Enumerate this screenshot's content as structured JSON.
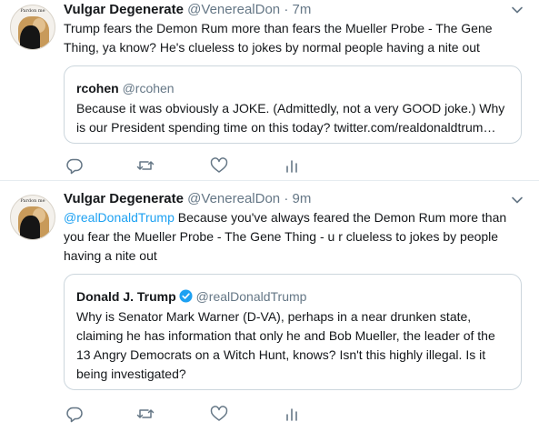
{
  "tweets": [
    {
      "name": "Vulgar Degenerate",
      "handle": "@VenerealDon",
      "separator": "·",
      "time": "7m",
      "avatar_caption": "Pardon me",
      "text": "Trump fears the Demon Rum more than fears the Mueller Probe - The Gene Thing, ya know? He's clueless to jokes by normal people having a nite out",
      "quote": {
        "name": "rcohen",
        "handle": "@rcohen",
        "text": "Because it was obviously a JOKE. (Admittedly, not a very GOOD joke.) Why is our President spending time on this today? twitter.com/realdonaldtrum…"
      },
      "actions": [
        "reply-icon",
        "retweet-icon",
        "like-icon",
        "analytics-icon"
      ]
    },
    {
      "name": "Vulgar Degenerate",
      "handle": "@VenerealDon",
      "separator": "·",
      "time": "9m",
      "avatar_caption": "Pardon me",
      "mention": "@realDonaldTrump",
      "text": " Because you've always feared the Demon Rum more than you fear the Mueller Probe - The Gene Thing - u r clueless to jokes by people having a nite out",
      "quote": {
        "name": "Donald J. Trump",
        "handle": "@realDonaldTrump",
        "verified": true,
        "text": "Why is Senator Mark Warner (D-VA), perhaps in a near drunken state, claiming he has information that only he and Bob Mueller, the leader of the 13 Angry Democrats on a Witch Hunt, knows? Isn't this highly illegal. Is it being investigated?"
      },
      "actions": [
        "reply-icon",
        "retweet-icon",
        "like-icon",
        "analytics-icon"
      ]
    }
  ],
  "colors": {
    "link": "#1da1f2",
    "secondary_text": "#657786",
    "border": "#ccd6dd",
    "icon": "#657786",
    "verified": "#1da1f2"
  }
}
